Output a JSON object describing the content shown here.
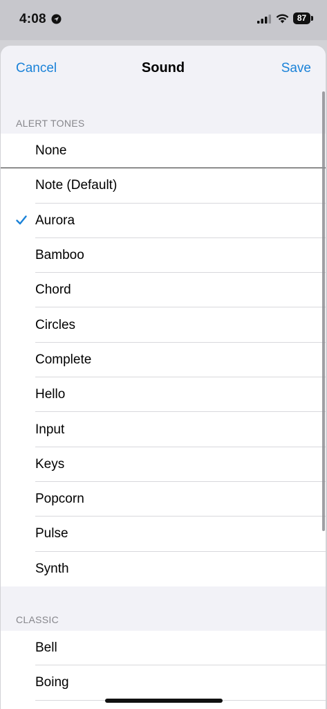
{
  "status_bar": {
    "time": "4:08",
    "battery": "87"
  },
  "nav": {
    "cancel_label": "Cancel",
    "title": "Sound",
    "save_label": "Save"
  },
  "sections": {
    "alert_tones": {
      "header": "ALERT TONES",
      "items": [
        {
          "label": "None",
          "selected": false
        },
        {
          "label": "Note (Default)",
          "selected": false
        },
        {
          "label": "Aurora",
          "selected": true
        },
        {
          "label": "Bamboo",
          "selected": false
        },
        {
          "label": "Chord",
          "selected": false
        },
        {
          "label": "Circles",
          "selected": false
        },
        {
          "label": "Complete",
          "selected": false
        },
        {
          "label": "Hello",
          "selected": false
        },
        {
          "label": "Input",
          "selected": false
        },
        {
          "label": "Keys",
          "selected": false
        },
        {
          "label": "Popcorn",
          "selected": false
        },
        {
          "label": "Pulse",
          "selected": false
        },
        {
          "label": "Synth",
          "selected": false
        }
      ]
    },
    "classic": {
      "header": "CLASSIC",
      "items": [
        {
          "label": "Bell",
          "selected": false
        },
        {
          "label": "Boing",
          "selected": false
        }
      ]
    }
  },
  "colors": {
    "accent": "#1a82d8",
    "background": "#f2f2f7",
    "header_text": "#86868b"
  },
  "icons": {
    "location": "location-arrow-icon",
    "signal": "cellular-signal-icon",
    "wifi": "wifi-icon",
    "battery": "battery-icon",
    "check": "checkmark-icon"
  }
}
